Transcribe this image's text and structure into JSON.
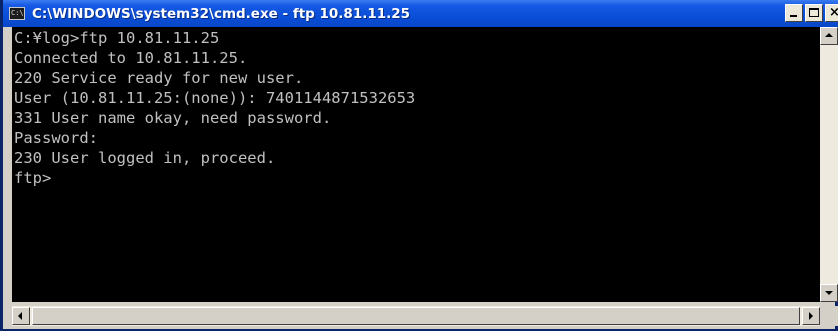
{
  "window": {
    "title": "C:\\WINDOWS\\system32\\cmd.exe - ftp 10.81.11.25",
    "icon": "cmd-prompt-icon",
    "icon_glyph": "C:\\",
    "controls": {
      "minimize": "minimize-icon",
      "maximize": "maximize-icon",
      "close": "close-icon",
      "close_glyph": "×"
    }
  },
  "console": {
    "lines": [
      "C:¥log>ftp 10.81.11.25",
      "Connected to 10.81.11.25.",
      "220 Service ready for new user.",
      "User (10.81.11.25:(none)): 7401144871532653",
      "331 User name okay, need password.",
      "Password:",
      "230 User logged in, proceed.",
      "ftp>"
    ],
    "colors": {
      "background": "#000000",
      "text": "#c0c0c0"
    }
  },
  "scrollbars": {
    "vertical": {
      "up": "scroll-up-arrow-icon",
      "down": "scroll-down-arrow-icon"
    },
    "horizontal": {
      "left": "scroll-left-arrow-icon",
      "right": "scroll-right-arrow-icon"
    }
  },
  "colors": {
    "titlebar": "#0a4fd8",
    "frame": "#0a246a",
    "chrome": "#d4d0c8"
  }
}
